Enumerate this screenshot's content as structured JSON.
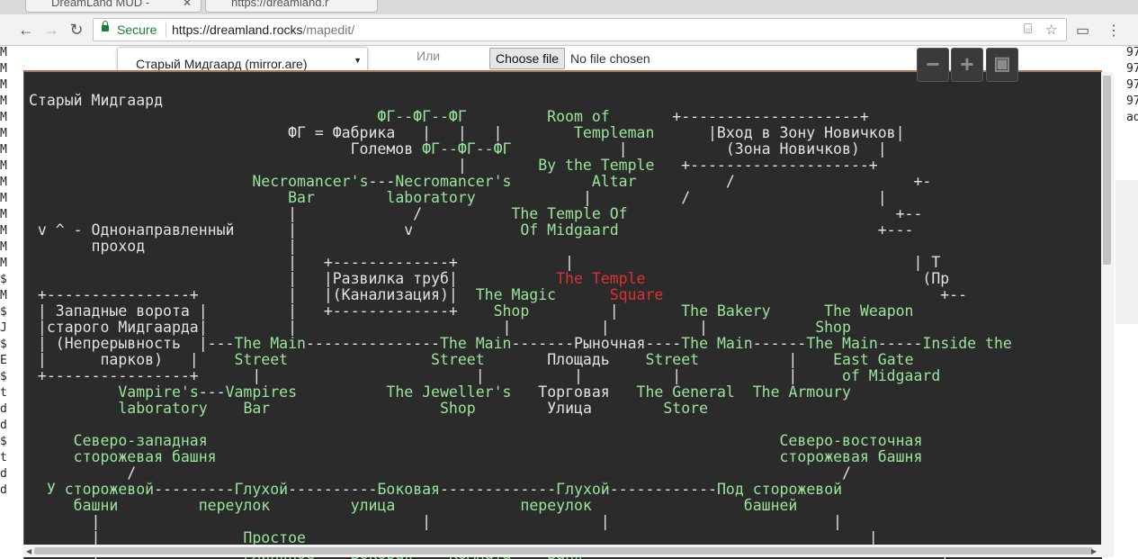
{
  "browser": {
    "tabs": [
      {
        "title": "DreamLand MUD -"
      },
      {
        "title": "https://dreamland.r"
      }
    ],
    "secure_label": "Secure",
    "url_host": "https://dreamland.rocks",
    "url_path": "/mapedit/"
  },
  "page": {
    "left_gutter": [
      "M",
      "M",
      "M",
      "M",
      "M",
      "M",
      "M",
      "M",
      "M",
      "M",
      "M",
      "M",
      "M",
      "M",
      "$",
      "M",
      "$",
      "J",
      "$",
      "E",
      "$",
      "t",
      "d",
      "d",
      "$",
      "t",
      "d",
      "d"
    ],
    "right_gutter": [
      "97",
      "97",
      "97",
      "97",
      "ad"
    ]
  },
  "editor": {
    "area_select": "Старый Мидгаард (mirror.are)",
    "or_label": "Или",
    "file_button": "Choose file",
    "file_status": "No file chosen",
    "zoom_out_icon": "minus-icon",
    "zoom_in_icon": "plus-icon",
    "save_icon": "floppy-disk-icon"
  },
  "map": {
    "colors": {
      "default": "#e2e2e2",
      "room": "#98e698",
      "current": "#e23030",
      "background": "#2b2b2b"
    },
    "lines": [
      [
        {
          "t": "Старый Мидгаард"
        }
      ],
      [
        {
          "t": "                                       "
        },
        {
          "t": "ФГ--ФГ--ФГ",
          "c": "g"
        },
        {
          "t": "         "
        },
        {
          "t": "Room of",
          "c": "g"
        },
        {
          "t": "       +--------------------+"
        }
      ],
      [
        {
          "t": "                             ФГ = Фабрика   |   |   |        "
        },
        {
          "t": "Templeman",
          "c": "g"
        },
        {
          "t": "      |Вход в Зону Новичков|"
        }
      ],
      [
        {
          "t": "                                    Големов "
        },
        {
          "t": "ФГ--ФГ--ФГ",
          "c": "g"
        },
        {
          "t": "            |           (Зона Новичков)  |"
        }
      ],
      [
        {
          "t": "                                                |        "
        },
        {
          "t": "By the Temple",
          "c": "g"
        },
        {
          "t": "   +--------------------+"
        }
      ],
      [
        {
          "t": "                         "
        },
        {
          "t": "Necromancer's",
          "c": "g"
        },
        {
          "t": "---"
        },
        {
          "t": "Necromancer's",
          "c": "g"
        },
        {
          "t": "         "
        },
        {
          "t": "Altar",
          "c": "g"
        },
        {
          "t": "          /                    +-"
        }
      ],
      [
        {
          "t": "                             "
        },
        {
          "t": "Bar",
          "c": "g"
        },
        {
          "t": "        "
        },
        {
          "t": "laboratory",
          "c": "g"
        },
        {
          "t": "            |          /                     |"
        }
      ],
      [
        {
          "t": "                             |             /          "
        },
        {
          "t": "The Temple Of",
          "c": "g"
        },
        {
          "t": "                              +--"
        }
      ],
      [
        {
          "t": " v ^ - Однонаправленный      |            v            "
        },
        {
          "t": "Of Midgaard",
          "c": "g"
        },
        {
          "t": "                             +---"
        }
      ],
      [
        {
          "t": "       проход                |"
        }
      ],
      [
        {
          "t": "                             |   +-------------+            |                                      | Т"
        }
      ],
      [
        {
          "t": "                             |   |Развилка труб|           "
        },
        {
          "t": "The Temple",
          "c": "r"
        },
        {
          "t": "                               (Пр"
        }
      ],
      [
        {
          "t": " +----------------+          |   |(Канализация)|  "
        },
        {
          "t": "The Magic",
          "c": "g"
        },
        {
          "t": "      "
        },
        {
          "t": "Square",
          "c": "r"
        },
        {
          "t": "                               +--"
        }
      ],
      [
        {
          "t": " | Западные ворота |         |   +-------------+    "
        },
        {
          "t": "Shop",
          "c": "g"
        },
        {
          "t": "         |       "
        },
        {
          "t": "The Bakery",
          "c": "g"
        },
        {
          "t": "      "
        },
        {
          "t": "The Weapon",
          "c": "g"
        }
      ],
      [
        {
          "t": " |старого Мидгаарда|         |                       |          |          |            "
        },
        {
          "t": "Shop",
          "c": "g"
        }
      ],
      [
        {
          "t": " | (Непрерывность  |---"
        },
        {
          "t": "The Main",
          "c": "g"
        },
        {
          "t": "---------------"
        },
        {
          "t": "The Main",
          "c": "g"
        },
        {
          "t": "-------Рыночная----"
        },
        {
          "t": "The Main",
          "c": "g"
        },
        {
          "t": "------"
        },
        {
          "t": "The Main",
          "c": "g"
        },
        {
          "t": "-----"
        },
        {
          "t": "Inside the",
          "c": "g"
        }
      ],
      [
        {
          "t": " |      парков)   |    "
        },
        {
          "t": "Street",
          "c": "g"
        },
        {
          "t": "                "
        },
        {
          "t": "Street",
          "c": "g"
        },
        {
          "t": "       Площадь    "
        },
        {
          "t": "Street",
          "c": "g"
        },
        {
          "t": "          |    "
        },
        {
          "t": "East Gate",
          "c": "g"
        }
      ],
      [
        {
          "t": " +----------------+      |                        |          |          |            |     "
        },
        {
          "t": "of Midgaard",
          "c": "g"
        }
      ],
      [
        {
          "t": "          "
        },
        {
          "t": "Vampire's",
          "c": "g"
        },
        {
          "t": "---"
        },
        {
          "t": "Vampires",
          "c": "g"
        },
        {
          "t": "          "
        },
        {
          "t": "The Jeweller's",
          "c": "g"
        },
        {
          "t": "   Торговая   "
        },
        {
          "t": "The General",
          "c": "g"
        },
        {
          "t": "  "
        },
        {
          "t": "The Armoury",
          "c": "g"
        }
      ],
      [
        {
          "t": "          "
        },
        {
          "t": "laboratory",
          "c": "g"
        },
        {
          "t": "    "
        },
        {
          "t": "Bar",
          "c": "g"
        },
        {
          "t": "                   "
        },
        {
          "t": "Shop",
          "c": "g"
        },
        {
          "t": "        Улица        "
        },
        {
          "t": "Store",
          "c": "g"
        }
      ],
      [
        {
          "t": ""
        }
      ],
      [
        {
          "t": "     "
        },
        {
          "t": "Северо-западная",
          "c": "g"
        },
        {
          "t": "                                                                "
        },
        {
          "t": "Северо-восточная",
          "c": "g"
        }
      ],
      [
        {
          "t": "     "
        },
        {
          "t": "сторожевая башня",
          "c": "g"
        },
        {
          "t": "                                                               "
        },
        {
          "t": "сторожевая башня",
          "c": "g"
        }
      ],
      [
        {
          "t": "           /                                                                               /"
        }
      ],
      [
        {
          "t": "  "
        },
        {
          "t": "У сторожевой",
          "c": "g"
        },
        {
          "t": "---------"
        },
        {
          "t": "Глухой",
          "c": "g"
        },
        {
          "t": "----------"
        },
        {
          "t": "Боковая",
          "c": "g"
        },
        {
          "t": "-------------"
        },
        {
          "t": "Глухой",
          "c": "g"
        },
        {
          "t": "------------"
        },
        {
          "t": "Под",
          "c": "g"
        },
        {
          "t": " "
        },
        {
          "t": "сторожевой",
          "c": "g"
        }
      ],
      [
        {
          "t": "     "
        },
        {
          "t": "башни",
          "c": "g"
        },
        {
          "t": "         "
        },
        {
          "t": "переулок",
          "c": "g"
        },
        {
          "t": "         "
        },
        {
          "t": "улица",
          "c": "g"
        },
        {
          "t": "              "
        },
        {
          "t": "переулок",
          "c": "g"
        },
        {
          "t": "                 "
        },
        {
          "t": "башней",
          "c": "g"
        }
      ],
      [
        {
          "t": "       |                                    |                   |                         |"
        }
      ],
      [
        {
          "t": "       |                "
        },
        {
          "t": "Простое",
          "c": "g"
        },
        {
          "t": "                                                               |"
        }
      ],
      [
        {
          "t": "       |                "
        },
        {
          "t": "глиняное",
          "c": "g"
        },
        {
          "t": "----"
        },
        {
          "t": "Боковая",
          "c": "g"
        },
        {
          "t": "----"
        },
        {
          "t": "Комната",
          "c": "g"
        },
        {
          "t": "----"
        },
        {
          "t": "Баня",
          "c": "g"
        },
        {
          "t": "                                        |"
        }
      ]
    ]
  }
}
